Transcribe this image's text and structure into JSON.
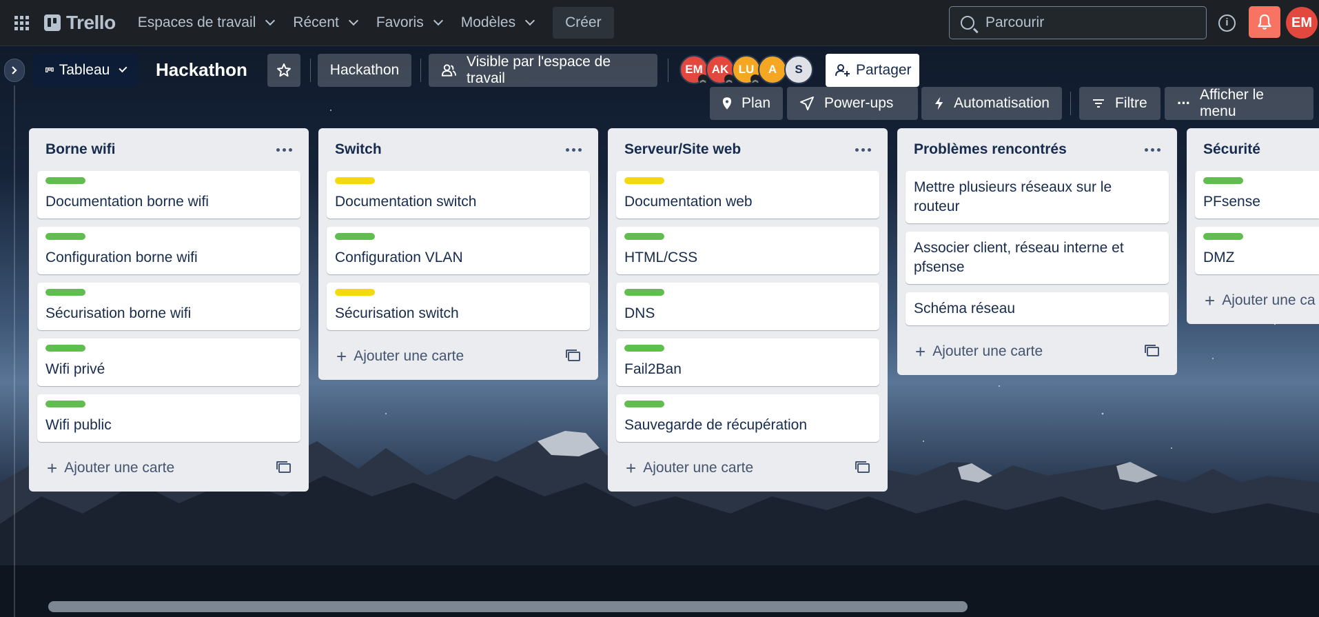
{
  "topbar": {
    "logo": "Trello",
    "nav": [
      {
        "label": "Espaces de travail"
      },
      {
        "label": "Récent"
      },
      {
        "label": "Favoris"
      },
      {
        "label": "Modèles"
      }
    ],
    "create_label": "Créer",
    "search_placeholder": "Parcourir",
    "user_initials": "EM"
  },
  "board": {
    "view_label": "Tableau",
    "title": "Hackathon",
    "workspace_label": "Hackathon",
    "visibility_label": "Visible par l'espace de travail",
    "members": [
      {
        "initials": "EM",
        "color": "#e2483d",
        "admin": true
      },
      {
        "initials": "AK",
        "color": "#e2483d",
        "admin": true
      },
      {
        "initials": "LU",
        "color": "#f5a623",
        "admin": true
      },
      {
        "initials": "A",
        "color": "#f5a623",
        "admin": false
      },
      {
        "initials": "S",
        "color": "#dfe1e6",
        "admin": false
      }
    ],
    "share_label": "Partager",
    "plan_label": "Plan",
    "powerups_label": "Power-ups",
    "automation_label": "Automatisation",
    "filter_label": "Filtre",
    "menu_label": "Afficher le menu"
  },
  "lists": [
    {
      "title": "Borne wifi",
      "cards": [
        {
          "label": "green",
          "title": "Documentation borne wifi"
        },
        {
          "label": "green",
          "title": "Configuration borne wifi"
        },
        {
          "label": "green",
          "title": "Sécurisation borne wifi"
        },
        {
          "label": "green",
          "title": "Wifi privé"
        },
        {
          "label": "green",
          "title": "Wifi public"
        }
      ],
      "add_label": "Ajouter une carte"
    },
    {
      "title": "Switch",
      "cards": [
        {
          "label": "yellow",
          "title": "Documentation switch"
        },
        {
          "label": "green",
          "title": "Configuration VLAN"
        },
        {
          "label": "yellow",
          "title": "Sécurisation switch"
        }
      ],
      "add_label": "Ajouter une carte"
    },
    {
      "title": "Serveur/Site web",
      "cards": [
        {
          "label": "yellow",
          "title": "Documentation web"
        },
        {
          "label": "green",
          "title": "HTML/CSS"
        },
        {
          "label": "green",
          "title": "DNS"
        },
        {
          "label": "green",
          "title": "Fail2Ban"
        },
        {
          "label": "green",
          "title": "Sauvegarde de récupération"
        }
      ],
      "add_label": "Ajouter une carte"
    },
    {
      "title": "Problèmes rencontrés",
      "cards": [
        {
          "label": "",
          "title": "Mettre plusieurs réseaux sur le routeur"
        },
        {
          "label": "",
          "title": "Associer client, réseau interne et pfsense"
        },
        {
          "label": "",
          "title": "Schéma réseau"
        }
      ],
      "add_label": "Ajouter une carte"
    },
    {
      "title": "Sécurité",
      "cards": [
        {
          "label": "green",
          "title": "PFsense"
        },
        {
          "label": "green",
          "title": "DMZ"
        }
      ],
      "add_label": "Ajouter une ca"
    }
  ]
}
